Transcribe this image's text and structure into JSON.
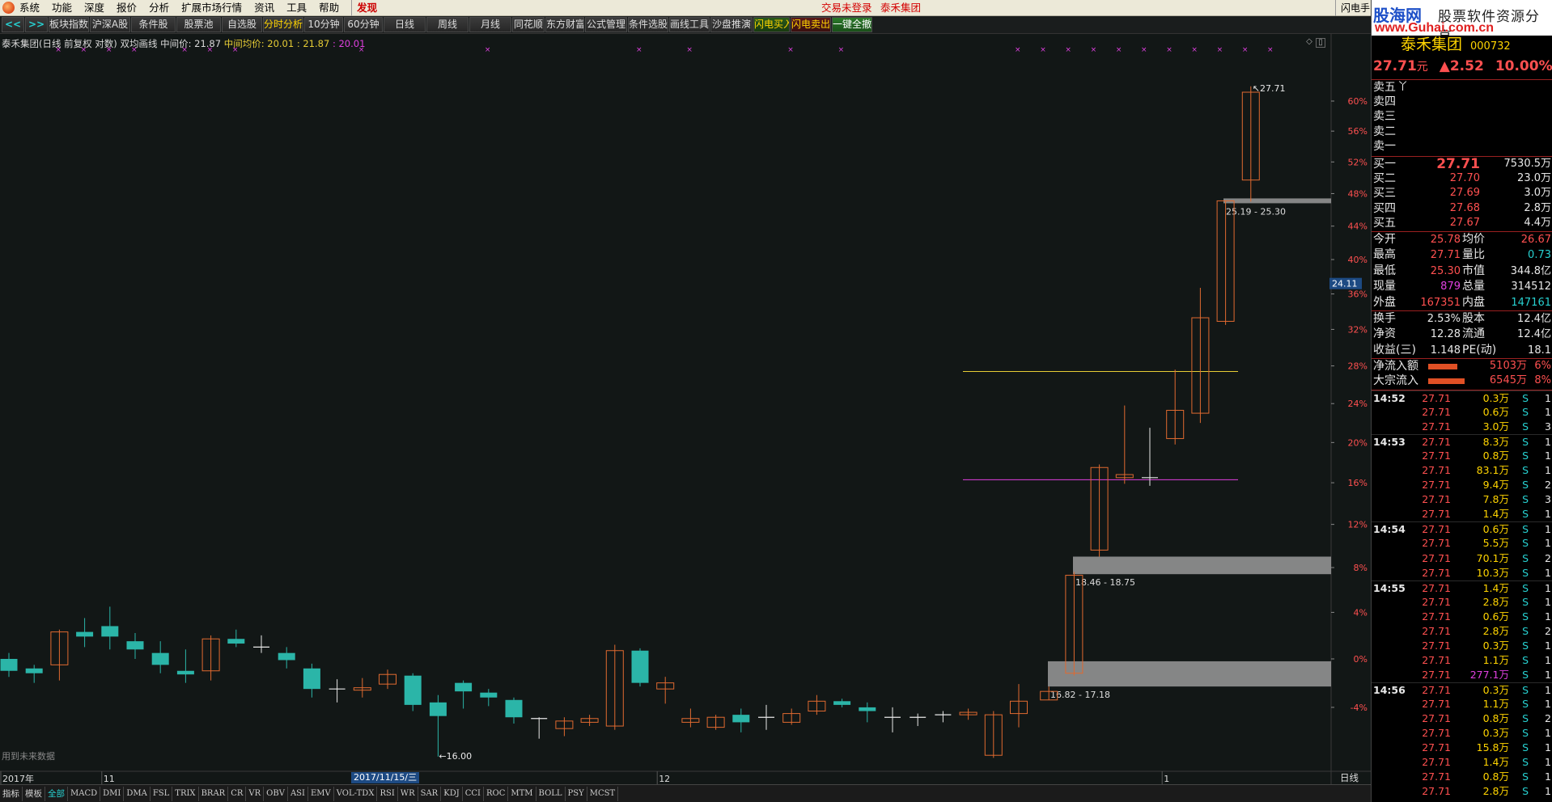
{
  "menubar": {
    "items": [
      "系统",
      "功能",
      "深度",
      "报价",
      "分析",
      "扩展市场行情",
      "资讯",
      "工具",
      "帮助"
    ],
    "discover": "发现",
    "trade_status": "交易未登录",
    "stock_name": "泰禾集团",
    "right_label": "闪电手"
  },
  "toolbar": {
    "buttons": [
      "<<",
      ">>",
      "板块指数",
      "沪深A股",
      "条件股",
      "股票池",
      "自选股",
      "分时分析",
      "10分钟",
      "60分钟",
      "日线",
      "周线",
      "月线",
      "同花顺",
      "东方财富",
      "公式管理",
      "条件选股",
      "画线工具",
      "沙盘推演",
      "闪电买入",
      "闪电卖出",
      "一键全撤"
    ]
  },
  "chart": {
    "info": {
      "title": "泰禾集团(日线 前复权 对数) 双均画线",
      "mid_label": "中间价: 21.87",
      "avg_label": "中间均价: 20.01 : 21.87",
      "avg_value": ": 20.01"
    },
    "future_note": "用到未来数据",
    "date_flag": "2017/11/15/三",
    "period": "日线",
    "x_labels": [
      {
        "label": "2017年",
        "bar": 0
      },
      {
        "label": "11",
        "bar": 4
      },
      {
        "label": "12",
        "bar": 26
      },
      {
        "label": "1",
        "bar": 46
      }
    ],
    "cursor_price": "24.11",
    "price_labels": {
      "high": "27.71",
      "low": "16.00"
    },
    "zones": [
      {
        "label": "25.19 - 25.30",
        "lo": 46.8,
        "hi": 47.4
      },
      {
        "label": "18.46 - 18.75",
        "lo": 7.4,
        "hi": 9.0
      },
      {
        "label": "16.82 - 17.18",
        "lo": -2.3,
        "hi": -0.2
      }
    ],
    "hlines": [
      {
        "pct": 27.4,
        "color": "#e6cc35"
      },
      {
        "pct": 16.3,
        "color": "#e040e0"
      }
    ],
    "controls": {
      "plus": "+",
      "minus": "-",
      "zero": "0"
    }
  },
  "chart_data": {
    "type": "candlestick",
    "y_axis": "percent change, log scale",
    "ylim": [
      -6.5,
      63
    ],
    "y_ticks": [
      -4,
      0,
      4,
      8,
      12,
      16,
      20,
      24,
      28,
      32,
      36,
      40,
      44,
      48,
      52,
      56,
      60
    ],
    "candles": [
      {
        "o": 0,
        "c": -1.0,
        "h": 0.5,
        "l": -1.5
      },
      {
        "o": -0.8,
        "c": -1.2,
        "h": -0.5,
        "l": -2.0
      },
      {
        "o": -0.5,
        "c": 2.3,
        "h": 2.5,
        "l": -1.8
      },
      {
        "o": 2.3,
        "c": 1.9,
        "h": 3.5,
        "l": 1.0
      },
      {
        "o": 2.8,
        "c": 1.9,
        "h": 4.5,
        "l": 0.8
      },
      {
        "o": 1.5,
        "c": 0.8,
        "h": 2.2,
        "l": 0.0
      },
      {
        "o": 0.5,
        "c": -0.5,
        "h": 1.5,
        "l": -1.2
      },
      {
        "o": -1.0,
        "c": -1.3,
        "h": 0.8,
        "l": -2.0
      },
      {
        "o": -1.0,
        "c": 1.7,
        "h": 2.0,
        "l": -1.8
      },
      {
        "o": 1.7,
        "c": 1.3,
        "h": 2.5,
        "l": 1.0
      },
      {
        "o": 1.0,
        "c": 0.9,
        "h": 2.0,
        "l": 0.5
      },
      {
        "o": 0.5,
        "c": -0.1,
        "h": 1.0,
        "l": -0.8
      },
      {
        "o": -0.8,
        "c": -2.5,
        "h": -0.4,
        "l": -3.2
      },
      {
        "o": -2.5,
        "c": -2.5,
        "h": -1.7,
        "l": -3.6
      },
      {
        "o": -2.6,
        "c": -2.4,
        "h": -1.6,
        "l": -3.2
      },
      {
        "o": -2.1,
        "c": -1.3,
        "h": -0.9,
        "l": -2.5
      },
      {
        "o": -1.4,
        "c": -3.8,
        "h": -1.2,
        "l": -4.3
      },
      {
        "o": -3.6,
        "c": -4.7,
        "h": -3.0,
        "l": -7.9
      },
      {
        "o": -2.0,
        "c": -2.7,
        "h": -1.8,
        "l": -4.1
      },
      {
        "o": -2.8,
        "c": -3.2,
        "h": -2.5,
        "l": -3.9
      },
      {
        "o": -3.4,
        "c": -4.8,
        "h": -3.2,
        "l": -5.3
      },
      {
        "o": -4.9,
        "c": -5.0,
        "h": -4.8,
        "l": -6.5
      },
      {
        "o": -5.7,
        "c": -5.1,
        "h": -4.8,
        "l": -6.3
      },
      {
        "o": -5.2,
        "c": -4.9,
        "h": -4.6,
        "l": -5.5
      },
      {
        "o": -5.5,
        "c": 0.7,
        "h": 1.2,
        "l": -5.8
      },
      {
        "o": 0.7,
        "c": -2.0,
        "h": 0.9,
        "l": -2.3
      },
      {
        "o": -2.5,
        "c": -2.0,
        "h": -1.5,
        "l": -3.7
      },
      {
        "o": -5.2,
        "c": -4.9,
        "h": -4.1,
        "l": -5.6
      },
      {
        "o": -5.6,
        "c": -4.8,
        "h": -4.6,
        "l": -5.8
      },
      {
        "o": -4.6,
        "c": -5.2,
        "h": -4.1,
        "l": -6.0
      },
      {
        "o": -4.8,
        "c": -4.8,
        "h": -3.8,
        "l": -5.8
      },
      {
        "o": -5.2,
        "c": -4.5,
        "h": -4.1,
        "l": -5.4
      },
      {
        "o": -4.3,
        "c": -3.5,
        "h": -3.0,
        "l": -4.6
      },
      {
        "o": -3.5,
        "c": -3.8,
        "h": -3.3,
        "l": -4.0
      },
      {
        "o": -4.0,
        "c": -4.3,
        "h": -3.6,
        "l": -5.2
      },
      {
        "o": -4.8,
        "c": -4.8,
        "h": -4.0,
        "l": -6.0
      },
      {
        "o": -4.8,
        "c": -4.9,
        "h": -4.5,
        "l": -5.5
      },
      {
        "o": -4.6,
        "c": -4.7,
        "h": -4.3,
        "l": -5.2
      },
      {
        "o": -4.6,
        "c": -4.4,
        "h": -4.1,
        "l": -5.0
      },
      {
        "o": -7.8,
        "c": -4.6,
        "h": -4.3,
        "l": -8.0
      },
      {
        "o": -4.5,
        "c": -3.5,
        "h": -2.1,
        "l": -5.6
      },
      {
        "o": -3.4,
        "c": -2.7,
        "h": -2.3,
        "l": -3.4
      },
      {
        "o": -1.2,
        "c": 7.3,
        "h": 7.6,
        "l": -1.4
      },
      {
        "o": 9.6,
        "c": 17.5,
        "h": 17.8,
        "l": 9.0
      },
      {
        "o": 16.5,
        "c": 16.8,
        "h": 23.8,
        "l": 15.9
      },
      {
        "o": 16.5,
        "c": 16.4,
        "h": 21.5,
        "l": 15.7
      },
      {
        "o": 20.4,
        "c": 23.3,
        "h": 27.6,
        "l": 19.8
      },
      {
        "o": 23.0,
        "c": 33.3,
        "h": 36.7,
        "l": 22.0
      },
      {
        "o": 32.9,
        "c": 47.1,
        "h": 47.1,
        "l": 32.5
      },
      {
        "o": 49.7,
        "c": 61.2,
        "h": 62.0,
        "l": 47.0
      }
    ]
  },
  "indicator_tabs": [
    "指标",
    "模板",
    "全部",
    "MACD",
    "DMI",
    "DMA",
    "FSL",
    "TRIX",
    "BRAR",
    "CR",
    "VR",
    "OBV",
    "ASI",
    "EMV",
    "VOL-TDX",
    "RSI",
    "WR",
    "SAR",
    "KDJ",
    "CCI",
    "ROC",
    "MTM",
    "BOLL",
    "PSY",
    "MCST"
  ],
  "panel": {
    "brand": {
      "site": "股海网",
      "slogan": "股票软件资源分享",
      "url": "www.Guhai.com.cn"
    },
    "stock": {
      "name": "泰禾集团",
      "code": "000732"
    },
    "quote": {
      "price": "27.71",
      "yuan": "元",
      "change": "▲2.52",
      "percent": "10.00%"
    },
    "asks": [
      {
        "label": "卖五",
        "price": "",
        "vol": "",
        "mark": "丫"
      },
      {
        "label": "卖四",
        "price": "",
        "vol": ""
      },
      {
        "label": "卖三",
        "price": "",
        "vol": ""
      },
      {
        "label": "卖二",
        "price": "",
        "vol": ""
      },
      {
        "label": "卖一",
        "price": "",
        "vol": ""
      }
    ],
    "bids": [
      {
        "label": "买一",
        "price": "27.71",
        "vol": "7530.5万"
      },
      {
        "label": "买二",
        "price": "27.70",
        "vol": "23.0万"
      },
      {
        "label": "买三",
        "price": "27.69",
        "vol": "3.0万"
      },
      {
        "label": "买四",
        "price": "27.68",
        "vol": "2.8万"
      },
      {
        "label": "买五",
        "price": "27.67",
        "vol": "4.4万"
      }
    ],
    "stats": [
      {
        "l1": "今开",
        "v1": "25.78",
        "c1": "#ff5050",
        "l2": "均价",
        "v2": "26.67",
        "c2": "#ff5050"
      },
      {
        "l1": "最高",
        "v1": "27.71",
        "c1": "#ff5050",
        "l2": "量比",
        "v2": "0.73",
        "c2": "#27d0d0"
      },
      {
        "l1": "最低",
        "v1": "25.30",
        "c1": "#ff5050",
        "l2": "市值",
        "v2": "344.8亿",
        "c2": "#e8e8e8"
      },
      {
        "l1": "现量",
        "v1": "879",
        "c1": "#e040e0",
        "l2": "总量",
        "v2": "314512",
        "c2": "#e8e8e8"
      },
      {
        "l1": "外盘",
        "v1": "167351",
        "c1": "#ff5050",
        "l2": "内盘",
        "v2": "147161",
        "c2": "#27d0d0"
      }
    ],
    "fundamentals": [
      {
        "l1": "换手",
        "v1": "2.53%",
        "l2": "股本",
        "v2": "12.4亿"
      },
      {
        "l1": "净资",
        "v1": "12.28",
        "l2": "流通",
        "v2": "12.4亿"
      },
      {
        "l1": "收益(三)",
        "v1": "1.148",
        "l2": "PE(动)",
        "v2": "18.1"
      }
    ],
    "flows": [
      {
        "label": "净流入额",
        "bar_pct": 60,
        "value": "5103万",
        "pct": "6%"
      },
      {
        "label": "大宗流入",
        "bar_pct": 75,
        "value": "6545万",
        "pct": "8%"
      }
    ],
    "ticks": [
      {
        "time": "14:52",
        "price": "27.71",
        "vol": "0.3万",
        "side": "S",
        "n": "1"
      },
      {
        "time": "",
        "price": "27.71",
        "vol": "0.6万",
        "side": "S",
        "n": "1"
      },
      {
        "time": "",
        "price": "27.71",
        "vol": "3.0万",
        "side": "S",
        "n": "3"
      },
      {
        "time": "14:53",
        "price": "27.71",
        "vol": "8.3万",
        "side": "S",
        "n": "1"
      },
      {
        "time": "",
        "price": "27.71",
        "vol": "0.8万",
        "side": "S",
        "n": "1"
      },
      {
        "time": "",
        "price": "27.71",
        "vol": "83.1万",
        "side": "S",
        "n": "1"
      },
      {
        "time": "",
        "price": "27.71",
        "vol": "9.4万",
        "side": "S",
        "n": "2"
      },
      {
        "time": "",
        "price": "27.71",
        "vol": "7.8万",
        "side": "S",
        "n": "3"
      },
      {
        "time": "",
        "price": "27.71",
        "vol": "1.4万",
        "side": "S",
        "n": "1"
      },
      {
        "time": "14:54",
        "price": "27.71",
        "vol": "0.6万",
        "side": "S",
        "n": "1"
      },
      {
        "time": "",
        "price": "27.71",
        "vol": "5.5万",
        "side": "S",
        "n": "1"
      },
      {
        "time": "",
        "price": "27.71",
        "vol": "70.1万",
        "side": "S",
        "n": "2"
      },
      {
        "time": "",
        "price": "27.71",
        "vol": "10.3万",
        "side": "S",
        "n": "1"
      },
      {
        "time": "14:55",
        "price": "27.71",
        "vol": "1.4万",
        "side": "S",
        "n": "1"
      },
      {
        "time": "",
        "price": "27.71",
        "vol": "2.8万",
        "side": "S",
        "n": "1"
      },
      {
        "time": "",
        "price": "27.71",
        "vol": "0.6万",
        "side": "S",
        "n": "1"
      },
      {
        "time": "",
        "price": "27.71",
        "vol": "2.8万",
        "side": "S",
        "n": "2"
      },
      {
        "time": "",
        "price": "27.71",
        "vol": "0.3万",
        "side": "S",
        "n": "1"
      },
      {
        "time": "",
        "price": "27.71",
        "vol": "1.1万",
        "side": "S",
        "n": "1"
      },
      {
        "time": "",
        "price": "27.71",
        "vol": "277.1万",
        "side": "S",
        "n": "1",
        "mag": true
      },
      {
        "time": "14:56",
        "price": "27.71",
        "vol": "0.3万",
        "side": "S",
        "n": "1"
      },
      {
        "time": "",
        "price": "27.71",
        "vol": "1.1万",
        "side": "S",
        "n": "1"
      },
      {
        "time": "",
        "price": "27.71",
        "vol": "0.8万",
        "side": "S",
        "n": "2"
      },
      {
        "time": "",
        "price": "27.71",
        "vol": "0.3万",
        "side": "S",
        "n": "1"
      },
      {
        "time": "",
        "price": "27.71",
        "vol": "15.8万",
        "side": "S",
        "n": "1"
      },
      {
        "time": "",
        "price": "27.71",
        "vol": "1.4万",
        "side": "S",
        "n": "1"
      },
      {
        "time": "",
        "price": "27.71",
        "vol": "0.8万",
        "side": "S",
        "n": "1"
      },
      {
        "time": "",
        "price": "27.71",
        "vol": "2.8万",
        "side": "S",
        "n": "1"
      }
    ]
  }
}
